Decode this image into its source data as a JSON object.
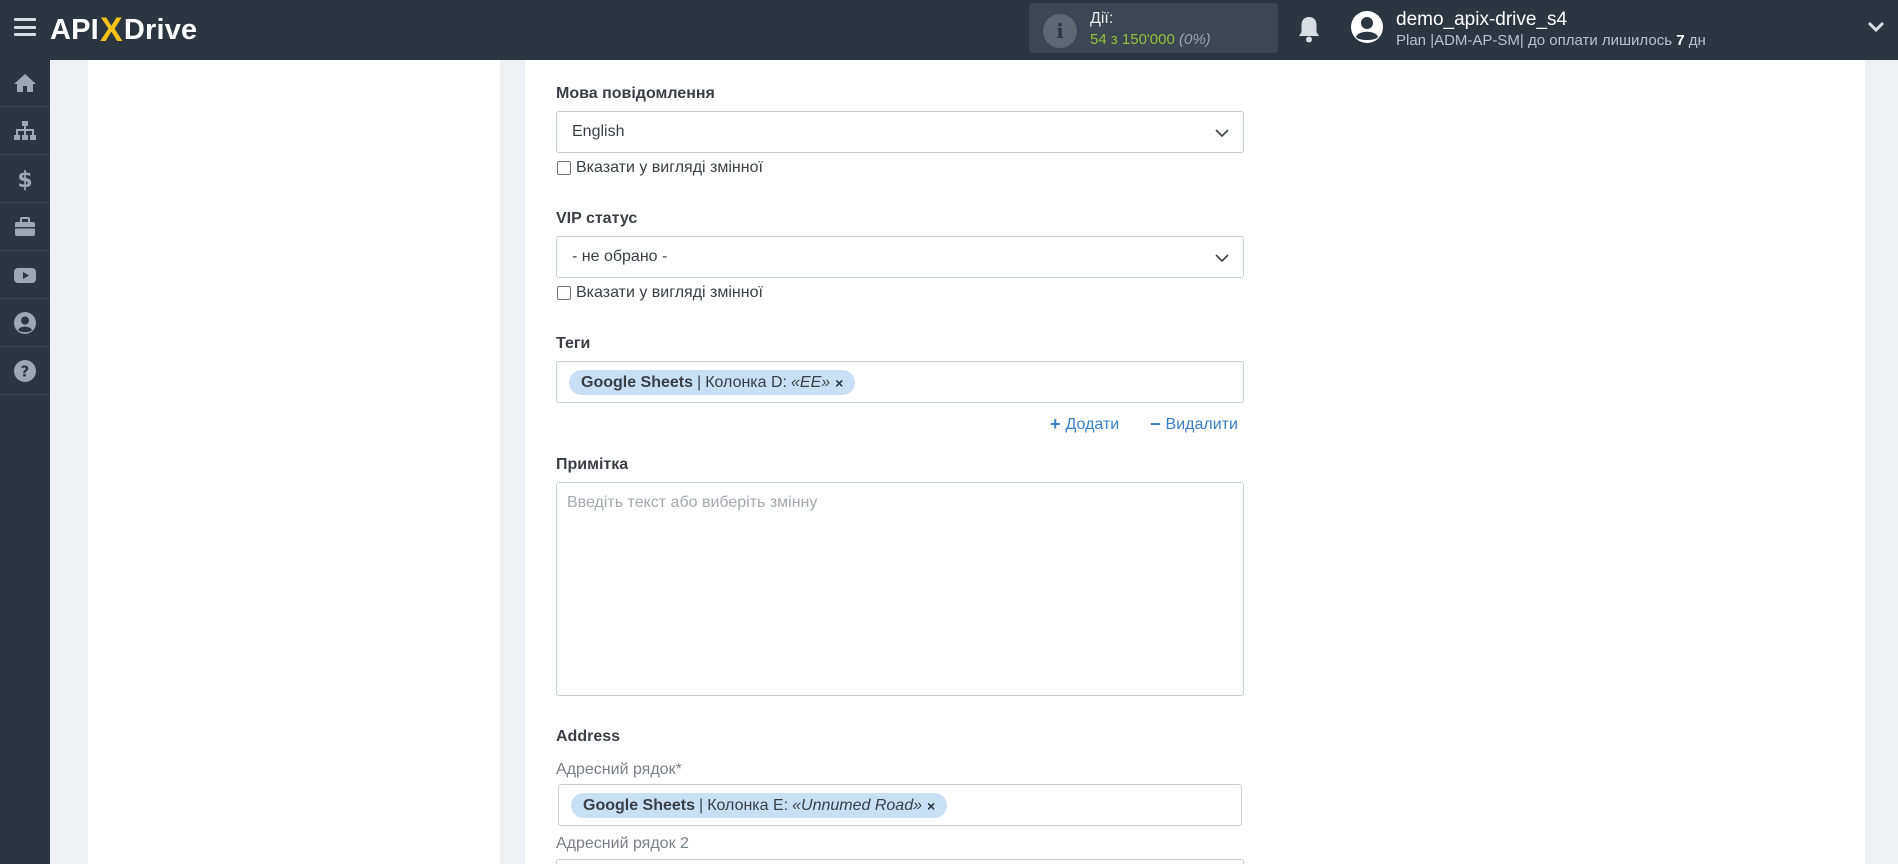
{
  "header": {
    "logo_left": "API",
    "logo_x": "X",
    "logo_right": "Drive",
    "actions_label": "Дії:",
    "actions_count": "54 з 150'000",
    "actions_percent": "(0%)",
    "user_name": "demo_apix-drive_s4",
    "plan_text": "Plan |ADM-AP-SM| до оплати лишилось ",
    "plan_days": "7",
    "plan_unit": " дн"
  },
  "sidebar": {
    "items": [
      {
        "icon": "home-icon"
      },
      {
        "icon": "sitemap-icon"
      },
      {
        "icon": "dollar-icon"
      },
      {
        "icon": "briefcase-icon"
      },
      {
        "icon": "youtube-icon"
      },
      {
        "icon": "user-circle-icon"
      },
      {
        "icon": "question-circle-icon"
      }
    ]
  },
  "form": {
    "message_language": {
      "label": "Мова повідомлення",
      "value": "English",
      "checkbox_label": "Вказати у вигляді змінної"
    },
    "vip_status": {
      "label": "VIP статус",
      "value": "- не обрано -",
      "checkbox_label": "Вказати у вигляді змінної"
    },
    "tags": {
      "label": "Теги",
      "tag": {
        "source": "Google Sheets",
        "column": "Колонка D:",
        "value": "«EE»",
        "remove": "×"
      },
      "add_label": "Додати",
      "remove_label": "Видалити"
    },
    "note": {
      "label": "Примітка",
      "placeholder": "Введіть текст або виберіть змінну"
    },
    "address": {
      "section_label": "Address",
      "line1_label": "Адресний рядок*",
      "line1_tag": {
        "source": "Google Sheets",
        "column": "Колонка E:",
        "value": "«Unnumed Road»",
        "remove": "×"
      },
      "line2_label": "Адресний рядок 2"
    }
  },
  "colors": {
    "topbar": "#2c3641",
    "accent_yellow": "#f7c21a",
    "link_blue": "#3b7fc4",
    "tag_bg": "#c8dff4",
    "count_green": "#8fc13d"
  }
}
